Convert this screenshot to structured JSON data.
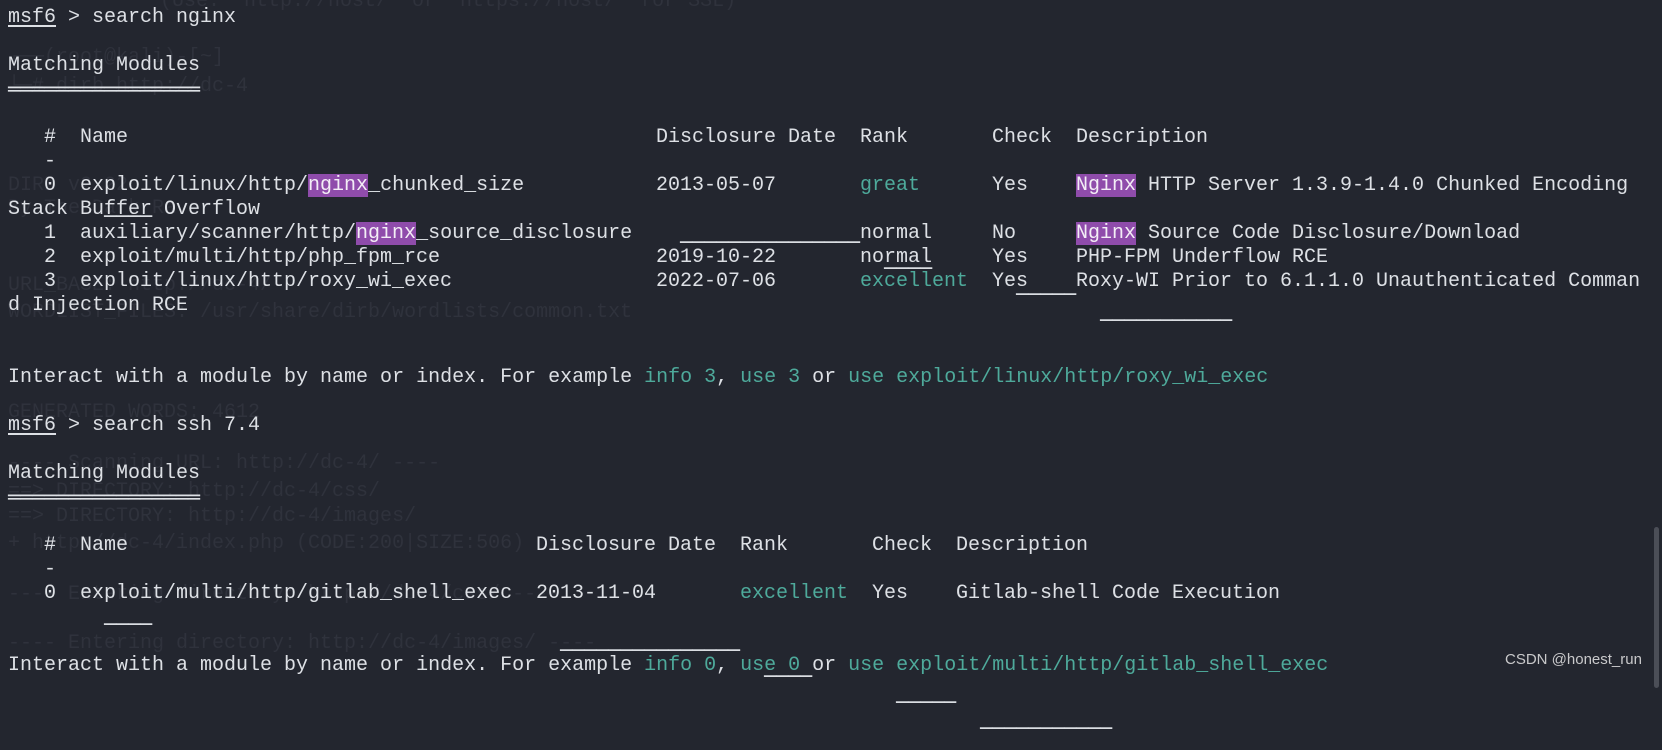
{
  "background_ghost_text": [
    "(Use: 'http://host/' or 'https://host/' for SSL)",
    "┌──(root@kali)-[~]",
    "└─# dirb http://dc-4",
    "DIRB v2.22",
    "By The Dark Raver",
    "URL_BASE: http://dc-4/",
    "WORDLIST_FILES: /usr/share/dirb/wordlists/common.txt",
    "GENERATED WORDS: 4612",
    "---- Scanning URL: http://dc-4/ ----",
    "==> DIRECTORY: http://dc-4/css/",
    "==> DIRECTORY: http://dc-4/images/",
    "+ http://dc-4/index.php (CODE:200|SIZE:506)",
    "---- Entering directory: http://dc-4/css/ ----",
    "---- Entering directory: http://dc-4/images/ ----"
  ],
  "colors": {
    "background": "#23262f",
    "text": "#dde0e5",
    "accent_teal": "#4eaa9b",
    "highlight_purple": "#8f4cab"
  },
  "session1": {
    "prompt": "msf6",
    "prompt_sep": " > ",
    "command": "search nginx",
    "title": "Matching Modules",
    "title_rule": "════════════════",
    "headers": {
      "idx": "#",
      "name": "Name",
      "date": "Disclosure Date",
      "rank": "Rank",
      "check": "Check",
      "desc": "Description"
    },
    "header_rules": {
      "idx": "-",
      "name": "────",
      "date": "───────────────",
      "rank": "────",
      "check": "─────",
      "desc": "───────────"
    },
    "rows": [
      {
        "idx": "0",
        "name_pre": "exploit/linux/http/",
        "name_hl": "nginx",
        "name_post": "_chunked_size",
        "date": "2013-05-07",
        "rank": "great",
        "check": "Yes",
        "desc_hl": "Nginx",
        "desc": " HTTP Server 1.3.9-1.4.0 Chunked Encoding",
        "desc_wrap": "Stack Buffer Overflow"
      },
      {
        "idx": "1",
        "name_pre": "auxiliary/scanner/http/",
        "name_hl": "nginx",
        "name_post": "_source_disclosure",
        "date": "",
        "rank": "normal",
        "check": "No",
        "desc_hl": "Nginx",
        "desc": " Source Code Disclosure/Download"
      },
      {
        "idx": "2",
        "name": "exploit/multi/http/php_fpm_rce",
        "date": "2019-10-22",
        "rank": "normal",
        "check": "Yes",
        "desc": "PHP-FPM Underflow RCE"
      },
      {
        "idx": "3",
        "name": "exploit/linux/http/roxy_wi_exec",
        "date": "2022-07-06",
        "rank": "excellent",
        "check": "Yes",
        "desc": "Roxy-WI Prior to 6.1.1.0 Unauthenticated Comman",
        "desc_wrap": "d Injection RCE"
      }
    ],
    "interact": {
      "text": "Interact with a module by name or index. For example ",
      "ex1": "info 3",
      "sep1": ", ",
      "ex2": "use 3",
      "sep2": " or ",
      "ex3": "use exploit/linux/http/roxy_wi_exec"
    }
  },
  "session2": {
    "prompt": "msf6",
    "prompt_sep": " > ",
    "command": "search ssh 7.4",
    "title": "Matching Modules",
    "title_rule": "════════════════",
    "headers": {
      "idx": "#",
      "name": "Name",
      "date": "Disclosure Date",
      "rank": "Rank",
      "check": "Check",
      "desc": "Description"
    },
    "header_rules": {
      "idx": "-",
      "name": "────",
      "date": "───────────────",
      "rank": "────",
      "check": "─────",
      "desc": "───────────"
    },
    "rows": [
      {
        "idx": "0",
        "name": "exploit/multi/http/gitlab_shell_exec",
        "date": "2013-11-04",
        "rank": "excellent",
        "check": "Yes",
        "desc": "Gitlab-shell Code Execution"
      }
    ],
    "interact": {
      "text": "Interact with a module by name or index. For example ",
      "ex1": "info 0",
      "sep1": ", ",
      "ex2": "use 0",
      "sep2": " or ",
      "ex3": "use exploit/multi/http/gitlab_shell_exec"
    }
  },
  "watermark": "CSDN @honest_run"
}
